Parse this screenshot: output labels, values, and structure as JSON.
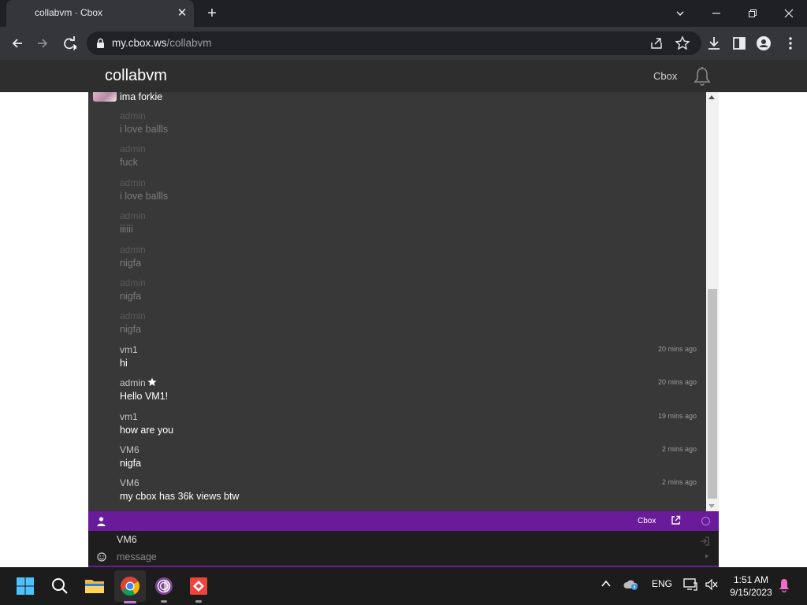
{
  "browser": {
    "tab_title": "collabvm · Cbox",
    "url_host": "my.cbox.ws",
    "url_path": "/collabvm"
  },
  "page": {
    "title": "collabvm",
    "header_link": "Cbox"
  },
  "chat": {
    "partial_first_message": "ima forkie",
    "messages": [
      {
        "name": "admin",
        "text": "i love ballls",
        "time": "",
        "faded": true
      },
      {
        "name": "admin",
        "text": "fuck",
        "time": "",
        "faded": true
      },
      {
        "name": "admin",
        "text": "i love ballls",
        "time": "",
        "faded": true
      },
      {
        "name": "admin",
        "text": "iiiiii",
        "time": "",
        "faded": true
      },
      {
        "name": "admin",
        "text": "nigfa",
        "time": "",
        "faded": true
      },
      {
        "name": "admin",
        "text": "nigfa",
        "time": "",
        "faded": true
      },
      {
        "name": "admin",
        "text": "nigfa",
        "time": "",
        "faded": true
      },
      {
        "name": "vm1",
        "text": "hi",
        "time": "20 mins ago",
        "faded": false
      },
      {
        "name": "admin",
        "text": "Hello VM1!",
        "time": "20 mins ago",
        "faded": false,
        "star": true
      },
      {
        "name": "vm1",
        "text": "how are you",
        "time": "19 mins ago",
        "faded": false
      },
      {
        "name": "VM6",
        "text": "nigfa",
        "time": "2 mins ago",
        "faded": false
      },
      {
        "name": "VM6",
        "text": "my cbox has 36k views btw",
        "time": "2 mins ago",
        "faded": false
      }
    ]
  },
  "cbox_bar": {
    "label": "Cbox"
  },
  "composer": {
    "username": "VM6",
    "placeholder": "message"
  },
  "taskbar": {
    "language": "ENG",
    "time": "1:51 AM",
    "date": "9/15/2023"
  },
  "colors": {
    "accent": "#6a1b9a",
    "chat_bg": "#383838",
    "header_bg": "#2e2e2e"
  }
}
